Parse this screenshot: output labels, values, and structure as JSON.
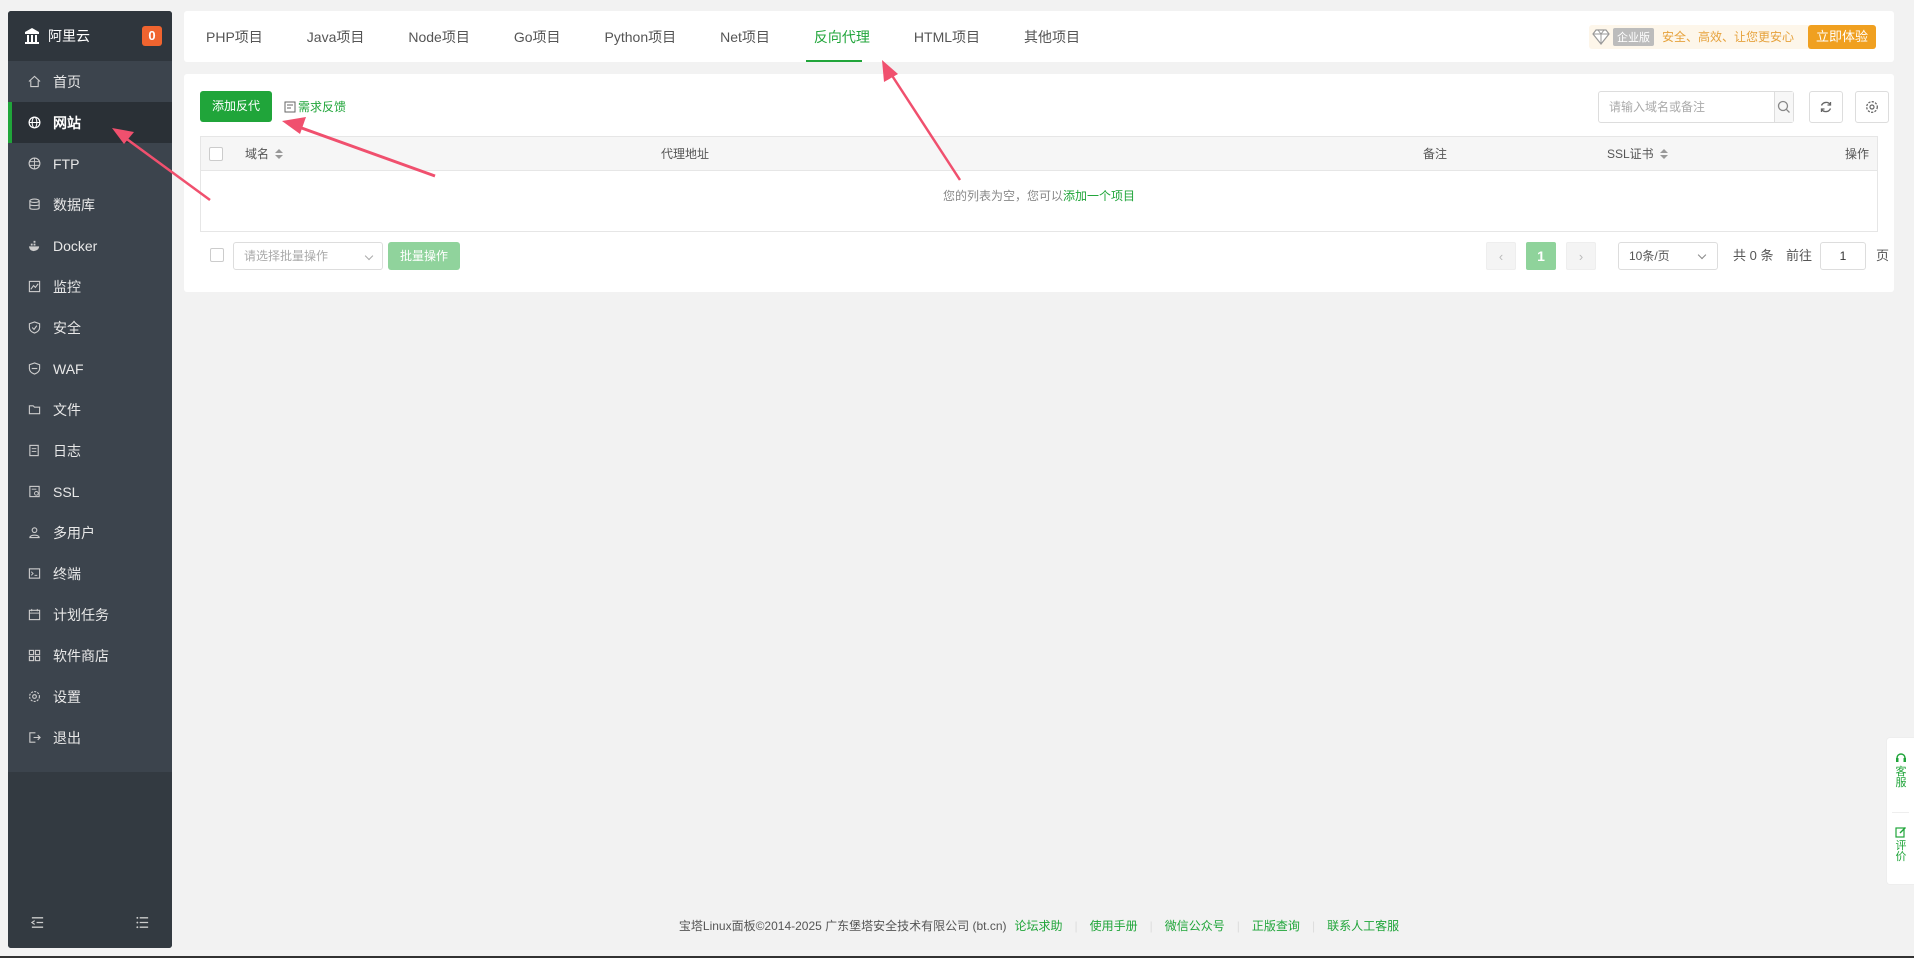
{
  "sidebar": {
    "title": "阿里云",
    "badge": "0",
    "items": [
      {
        "label": "首页",
        "icon": "home-icon"
      },
      {
        "label": "网站",
        "icon": "globe-icon",
        "active": true
      },
      {
        "label": "FTP",
        "icon": "ftp-icon"
      },
      {
        "label": "数据库",
        "icon": "database-icon"
      },
      {
        "label": "Docker",
        "icon": "docker-icon"
      },
      {
        "label": "监控",
        "icon": "monitor-icon"
      },
      {
        "label": "安全",
        "icon": "shield-icon"
      },
      {
        "label": "WAF",
        "icon": "waf-icon"
      },
      {
        "label": "文件",
        "icon": "folder-icon"
      },
      {
        "label": "日志",
        "icon": "log-icon"
      },
      {
        "label": "SSL",
        "icon": "ssl-icon"
      },
      {
        "label": "多用户",
        "icon": "users-icon"
      },
      {
        "label": "终端",
        "icon": "terminal-icon"
      },
      {
        "label": "计划任务",
        "icon": "calendar-icon"
      },
      {
        "label": "软件商店",
        "icon": "apps-icon"
      },
      {
        "label": "设置",
        "icon": "gear-icon"
      },
      {
        "label": "退出",
        "icon": "logout-icon"
      }
    ]
  },
  "tabs": [
    {
      "label": "PHP项目"
    },
    {
      "label": "Java项目"
    },
    {
      "label": "Node项目"
    },
    {
      "label": "Go项目"
    },
    {
      "label": "Python项目"
    },
    {
      "label": "Net项目"
    },
    {
      "label": "反向代理",
      "active": true
    },
    {
      "label": "HTML项目"
    },
    {
      "label": "其他项目"
    }
  ],
  "promo": {
    "edition": "企业版",
    "slogan": "安全、高效、让您更安心",
    "try_label": "立即体验"
  },
  "toolbar": {
    "add_label": "添加反代",
    "feedback_label": "需求反馈",
    "search_placeholder": "请输入域名或备注"
  },
  "table": {
    "columns": {
      "domain": "域名",
      "proxy": "代理地址",
      "remark": "备注",
      "ssl": "SSL证书",
      "ops": "操作"
    },
    "empty_text": "您的列表为空，您可以",
    "empty_link": "添加一个项目"
  },
  "batch": {
    "select_placeholder": "请选择批量操作",
    "button_label": "批量操作"
  },
  "pagination": {
    "prev": "‹",
    "current": "1",
    "next": "›",
    "per_page": "10条/页",
    "total_text": "共 0 条",
    "goto_label": "前往",
    "goto_value": "1",
    "page_suffix": "页"
  },
  "float": {
    "service": "客服",
    "review": "评价"
  },
  "footer": {
    "copyright": "宝塔Linux面板©2014-2025 广东堡塔安全技术有限公司 (bt.cn)",
    "links": [
      "论坛求助",
      "使用手册",
      "微信公众号",
      "正版查询",
      "联系人工客服"
    ]
  },
  "colors": {
    "accent": "#20a53a",
    "sidebar_bg": "#3c444d",
    "annotation_arrow": "#f0506e"
  }
}
